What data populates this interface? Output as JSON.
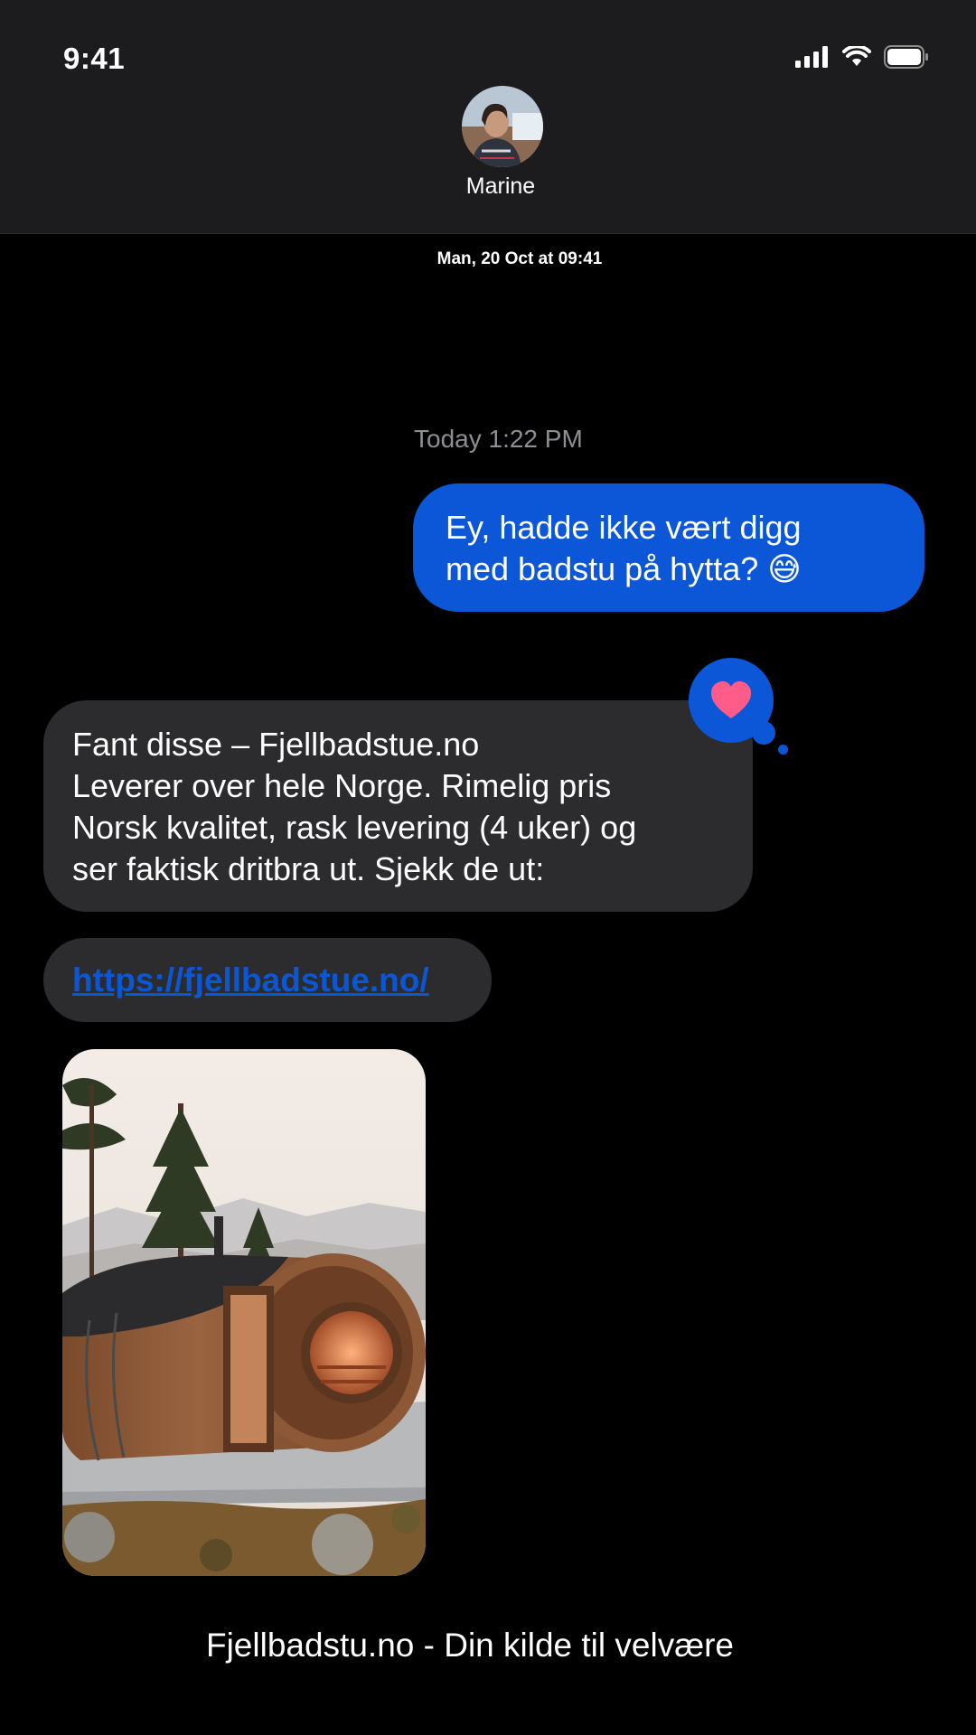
{
  "status_bar": {
    "time": "9:41"
  },
  "contact": {
    "name": "Marine"
  },
  "thread": {
    "date_stamp": "Man,  20 Oct at 09:41",
    "time_label": "Today 1:22 PM"
  },
  "messages": {
    "outgoing": {
      "line1": "Ey, hadde ikke vært digg",
      "line2": "med badstu på hytta? 😅"
    },
    "incoming": {
      "line1": "Fant disse – Fjellbadstue.no",
      "line2": "Leverer over hele Norge. Rimelig pris",
      "line3": "Norsk kvalitet, rask levering (4 uker) og",
      "line4": "ser faktisk dritbra ut. Sjekk de ut:"
    },
    "link": "https://fjellbadstue.no/",
    "reaction": "heart-icon"
  },
  "footer": {
    "text": "Fjellbadstu.no - Din kilde til velvære"
  },
  "colors": {
    "bubble_outgoing": "#0b57d8",
    "bubble_incoming": "#2c2c2e",
    "heart": "#ff5c8a",
    "link": "#0a57d6"
  }
}
